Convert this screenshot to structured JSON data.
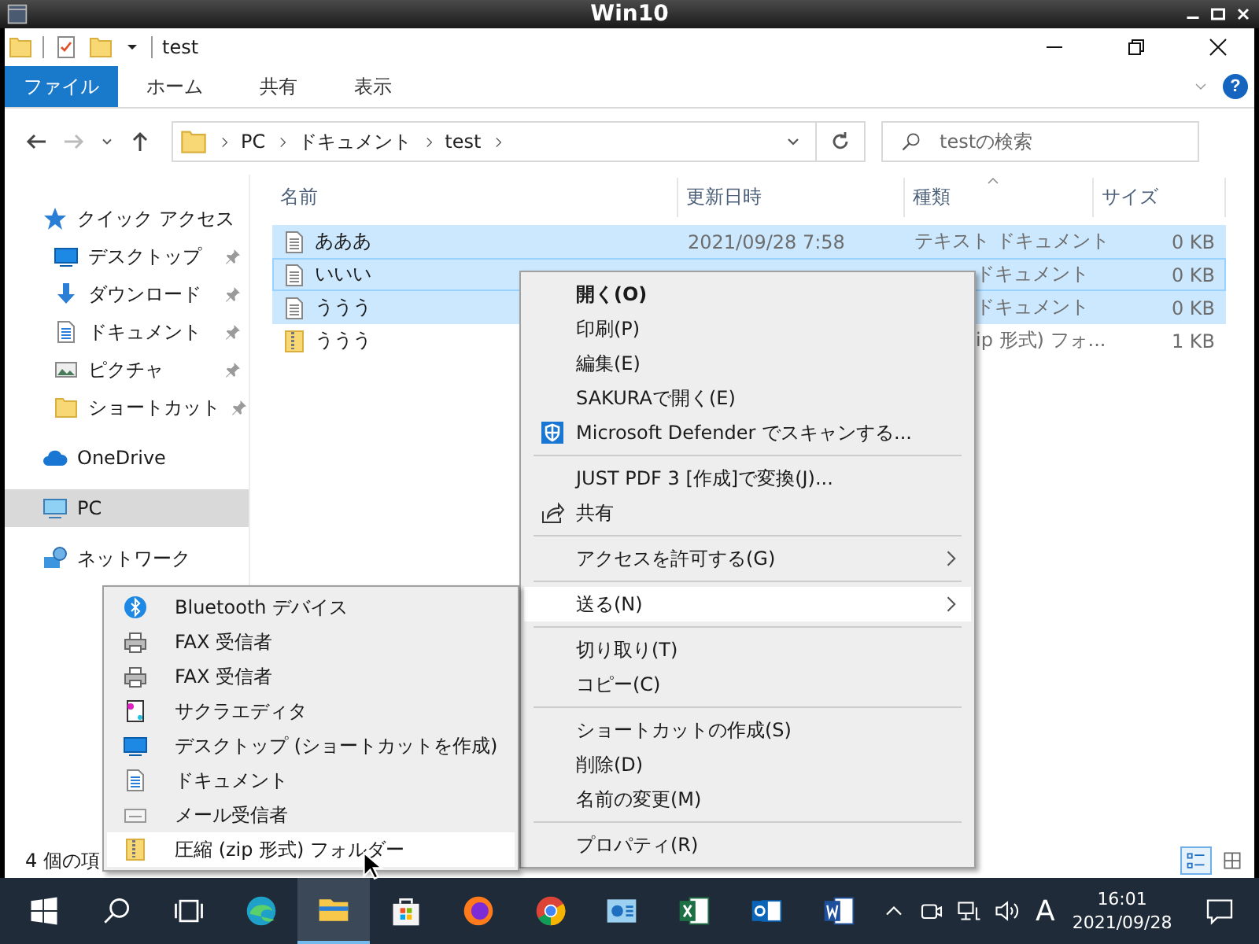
{
  "window": {
    "title": "Win10"
  },
  "quick_toolbar": {
    "title": "test"
  },
  "ribbon": {
    "tabs": [
      {
        "label": "ファイル",
        "selected": true
      },
      {
        "label": "ホーム",
        "selected": false
      },
      {
        "label": "共有",
        "selected": false
      },
      {
        "label": "表示",
        "selected": false
      }
    ],
    "help": "?"
  },
  "address": {
    "path": [
      "PC",
      "ドキュメント",
      "test"
    ]
  },
  "search": {
    "placeholder": "testの検索"
  },
  "sidebar": {
    "items": [
      {
        "label": "クイック アクセス",
        "kind": "star",
        "selected": false,
        "children": [
          {
            "label": "デスクトップ",
            "kind": "desktop",
            "pinned": true,
            "selected": false
          },
          {
            "label": "ダウンロード",
            "kind": "download",
            "pinned": true,
            "selected": false
          },
          {
            "label": "ドキュメント",
            "kind": "docs",
            "pinned": true,
            "selected": false
          },
          {
            "label": "ピクチャ",
            "kind": "pictures",
            "pinned": true,
            "selected": false
          },
          {
            "label": "ショートカット",
            "kind": "folder",
            "pinned": true,
            "selected": false
          }
        ]
      },
      {
        "label": "OneDrive",
        "kind": "cloud",
        "selected": false
      },
      {
        "label": "PC",
        "kind": "pc",
        "selected": true
      },
      {
        "label": "ネットワーク",
        "kind": "network",
        "selected": false
      }
    ]
  },
  "table": {
    "columns": [
      {
        "label": "名前",
        "sorted": false
      },
      {
        "label": "更新日時",
        "sorted": false
      },
      {
        "label": "種類",
        "sorted": true
      },
      {
        "label": "サイズ",
        "sorted": false
      }
    ],
    "rows": [
      {
        "name": "あああ",
        "kind": "text",
        "date": "2021/09/28 7:58",
        "type": "テキスト ドキュメント",
        "type_clipped": false,
        "size": "0 KB",
        "selected": true,
        "focused": false
      },
      {
        "name": "いいい",
        "kind": "text",
        "type": "ドキュメント",
        "type_clipped": true,
        "size": "0 KB",
        "selected": true,
        "focused": true
      },
      {
        "name": "ううう",
        "kind": "text",
        "type": "ドキュメント",
        "type_clipped": true,
        "size": "0 KB",
        "selected": true,
        "focused": false
      },
      {
        "name": "ううう",
        "kind": "zip",
        "type": "ip 形式) フォ...",
        "type_clipped": true,
        "size": "1 KB",
        "selected": false,
        "focused": false
      }
    ]
  },
  "status_bar": {
    "count": "4 個の項",
    "views": [
      {
        "kind": "details",
        "selected": true
      },
      {
        "kind": "tiles",
        "selected": false
      }
    ]
  },
  "context_menu": {
    "items": [
      {
        "kind": "item",
        "label": "開く(O)",
        "bold": true,
        "selected": false
      },
      {
        "kind": "item",
        "label": "印刷(P)",
        "bold": false,
        "selected": false
      },
      {
        "kind": "item",
        "label": "編集(E)",
        "bold": false,
        "selected": false
      },
      {
        "kind": "item",
        "label": "SAKURAで開く(E)",
        "bold": false,
        "selected": false
      },
      {
        "kind": "shield",
        "label": "Microsoft Defender でスキャンする...",
        "bold": false,
        "selected": false
      },
      {
        "kind": "separator"
      },
      {
        "kind": "item",
        "label": "JUST PDF 3 [作成]で変換(J)...",
        "bold": false,
        "selected": false
      },
      {
        "kind": "share",
        "label": "共有",
        "bold": false,
        "selected": false
      },
      {
        "kind": "separator"
      },
      {
        "kind": "item",
        "label": "アクセスを許可する(G)",
        "submenu": true,
        "bold": false,
        "selected": false
      },
      {
        "kind": "separator"
      },
      {
        "kind": "item",
        "label": "送る(N)",
        "submenu": true,
        "bold": false,
        "selected": true
      },
      {
        "kind": "separator"
      },
      {
        "kind": "item",
        "label": "切り取り(T)",
        "bold": false,
        "selected": false
      },
      {
        "kind": "item",
        "label": "コピー(C)",
        "bold": false,
        "selected": false
      },
      {
        "kind": "separator"
      },
      {
        "kind": "item",
        "label": "ショートカットの作成(S)",
        "bold": false,
        "selected": false
      },
      {
        "kind": "item",
        "label": "削除(D)",
        "bold": false,
        "selected": false
      },
      {
        "kind": "item",
        "label": "名前の変更(M)",
        "bold": false,
        "selected": false
      },
      {
        "kind": "separator"
      },
      {
        "kind": "item",
        "label": "プロパティ(R)",
        "bold": false,
        "selected": false
      }
    ]
  },
  "send_to_menu": {
    "items": [
      {
        "label": "Bluetooth デバイス",
        "kind": "bluetooth",
        "selected": false
      },
      {
        "label": "FAX 受信者",
        "kind": "fax",
        "selected": false
      },
      {
        "label": "FAX 受信者",
        "kind": "fax",
        "selected": false
      },
      {
        "label": "サクラエディタ",
        "kind": "sakura",
        "selected": false
      },
      {
        "label": "デスクトップ (ショートカットを作成)",
        "kind": "desktop",
        "selected": false
      },
      {
        "label": "ドキュメント",
        "kind": "docs",
        "selected": false
      },
      {
        "label": "メール受信者",
        "kind": "mail",
        "selected": false
      },
      {
        "label": "圧縮 (zip 形式) フォルダー",
        "kind": "zip",
        "selected": true
      }
    ]
  },
  "taskbar": {
    "apps": [
      {
        "kind": "start",
        "active": false
      },
      {
        "kind": "search",
        "active": false
      },
      {
        "kind": "taskview",
        "active": false
      },
      {
        "kind": "edge",
        "active": false
      },
      {
        "kind": "explorer",
        "active": true
      },
      {
        "kind": "store",
        "active": false
      },
      {
        "kind": "firefox",
        "active": false
      },
      {
        "kind": "chrome",
        "active": false
      },
      {
        "kind": "app",
        "active": false
      },
      {
        "kind": "excel",
        "active": false
      },
      {
        "kind": "outlook",
        "active": false
      },
      {
        "kind": "word",
        "active": false
      }
    ],
    "tray": [
      {
        "kind": "chevron"
      },
      {
        "kind": "camera"
      },
      {
        "kind": "network"
      },
      {
        "kind": "volume"
      }
    ],
    "ime": "A",
    "time": "16:01",
    "date": "2021/09/28"
  }
}
